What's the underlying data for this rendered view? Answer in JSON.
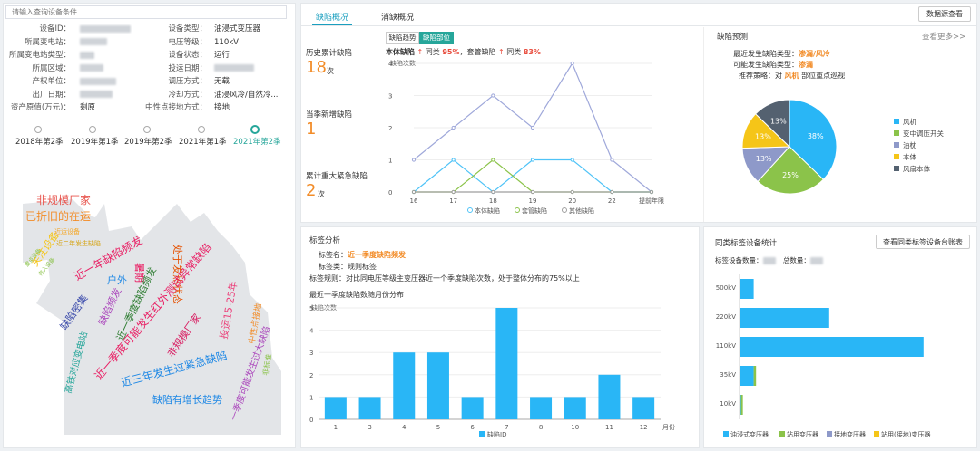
{
  "search": {
    "placeholder": "请输入查询设备条件"
  },
  "equipment_info": {
    "left": [
      {
        "label": "设备ID："
      },
      {
        "label": "所属变电站："
      },
      {
        "label": "所属变电站类型："
      },
      {
        "label": "所属区域："
      },
      {
        "label": "产权单位："
      },
      {
        "label": "出厂日期："
      },
      {
        "label": "资产原值(万元)：",
        "value": "剩原"
      }
    ],
    "right": [
      {
        "label": "设备类型：",
        "value": "油浸式变压器"
      },
      {
        "label": "电压等级：",
        "value": "110kV"
      },
      {
        "label": "设备状态：",
        "value": "运行"
      },
      {
        "label": "投运日期："
      },
      {
        "label": "调压方式：",
        "value": "无载"
      },
      {
        "label": "冷却方式：",
        "value": "油浸风冷/自然冷..."
      },
      {
        "label": "中性点接地方式：",
        "value": "接地"
      }
    ]
  },
  "timeline": {
    "items": [
      "2018年第2季",
      "2019年第1季",
      "2019年第2季",
      "2021年第1季",
      "2021年第2季"
    ],
    "active_index": 4
  },
  "word_cloud": [
    {
      "text": "非规模厂家",
      "color": "#e8554e"
    },
    {
      "text": "已折旧的在运",
      "color": "#f28c28"
    },
    {
      "text": "近运设备",
      "color": "#f5a623"
    },
    {
      "text": "近二年发生缺陷",
      "color": "#d6a517"
    },
    {
      "text": "关注设备",
      "color": "#f5c518"
    },
    {
      "text": "重点设备",
      "color": "#8bc34a"
    },
    {
      "text": "存入设备",
      "color": "#8bc34a"
    },
    {
      "text": "近一年缺陷频发",
      "color": "#e91e63"
    },
    {
      "text": "户外",
      "color": "#1e88e5"
    },
    {
      "text": "暑期",
      "color": "#1e88e5"
    },
    {
      "text": "处于发热状态",
      "color": "#e65100"
    },
    {
      "text": "近一季度缺陷频发",
      "color": "#2e7d32"
    },
    {
      "text": "缺陷密集",
      "color": "#3949ab"
    },
    {
      "text": "缺陷频发",
      "color": "#ab47bc"
    },
    {
      "text": "近三年发生过紧急缺陷",
      "color": "#1e88e5"
    },
    {
      "text": "高铁对应变电站",
      "color": "#26a69a"
    },
    {
      "text": "近一季度可能发生红外测试异常缺陷",
      "color": "#e91e63"
    },
    {
      "text": "缺陷有增长趋势",
      "color": "#1e88e5"
    },
    {
      "text": "非规模厂家",
      "color": "#d81b60"
    },
    {
      "text": "投运15-25年",
      "color": "#ec407a"
    },
    {
      "text": "中性点接地",
      "color": "#f28c28"
    },
    {
      "text": "非标准",
      "color": "#8bc34a"
    },
    {
      "text": "一季度可能发生过大缺陷",
      "color": "#ab47bc"
    },
    {
      "text": "缺陷有增长趋势",
      "color": "#1e88e5"
    }
  ],
  "tabs": {
    "items": [
      "缺陷概况",
      "消缺概况"
    ],
    "active_index": 0
  },
  "data_source_button": "数据源查看",
  "defect_stats": {
    "history_label": "历史累计缺陷",
    "history_value": "18",
    "history_unit": "次",
    "new_label": "当季新增缺陷",
    "new_value": "1",
    "urgent_label": "累计重大紧急缺陷",
    "urgent_value": "2",
    "urgent_unit": "次"
  },
  "trend_chart": {
    "subtabs": [
      "缺陷趋势",
      "缺陷部位"
    ],
    "summary_prefix": "本体缺陷",
    "summary_mid1": "同类",
    "summary_val1": "95%",
    "summary_mid2": "，套管缺陷",
    "summary_mid3": "同类",
    "summary_val2": "83%"
  },
  "prediction": {
    "title": "缺陷预测",
    "more": "查看更多>>",
    "line1_label": "最近发生缺陷类型：",
    "line1_value": "渗漏/风冷",
    "line2_label": "可能发生缺陷类型：",
    "line2_value": "渗漏",
    "line3_prefix": "推荐策略：对",
    "line3_value": "风机",
    "line3_suffix": "部位重点巡视"
  },
  "tag_analysis": {
    "title": "标签分析",
    "name_label": "标签名：",
    "name_value": "近一季度缺陷频发",
    "type_label": "标签类：",
    "type_value": "规则标签",
    "rule_label": "标签规则：",
    "rule_value": "对比同电压等级主变压器近一个季度缺陷次数，处于整体分布的75%以上"
  },
  "same_tag": {
    "title": "同类标签设备统计",
    "button": "查看同类标签设备台账表",
    "count_label": "标签设备数量：",
    "total_label": "总数量："
  },
  "chart_data": [
    {
      "type": "line",
      "title": "",
      "ylabel": "缺陷次数",
      "xlabel": "",
      "x": [
        "16",
        "17",
        "18",
        "19",
        "20",
        "22",
        "提前年限"
      ],
      "ylim": [
        0,
        4
      ],
      "series": [
        {
          "name": "",
          "values": [
            1,
            2,
            3,
            2,
            4,
            1,
            0
          ],
          "color": "#9fa8da"
        },
        {
          "name": "本体缺陷",
          "values": [
            0,
            1,
            0,
            1,
            1,
            0,
            0
          ],
          "color": "#4fc3f7"
        },
        {
          "name": "套管缺陷",
          "values": [
            0,
            0,
            1,
            0,
            0,
            0,
            0
          ],
          "color": "#8bc34a"
        },
        {
          "name": "其他缺陷",
          "values": [
            0,
            0,
            0,
            0,
            0,
            0,
            0
          ],
          "color": "#9e9e9e"
        }
      ]
    },
    {
      "type": "pie",
      "categories": [
        "风机",
        "变中调压开关",
        "油枕",
        "本体",
        "风扇本体"
      ],
      "values": [
        38,
        25,
        13,
        13,
        13
      ],
      "labels": [
        "38%",
        "25%",
        "13%",
        "13%",
        "13%"
      ],
      "colors": [
        "#29b6f6",
        "#8bc34a",
        "#8e99c9",
        "#f5c518",
        "#546170"
      ],
      "legend": "right"
    },
    {
      "type": "bar",
      "title": "最近一季度缺陷数随月份分布",
      "ylabel": "缺陷次数",
      "xlabel": "月份",
      "categories": [
        "1",
        "3",
        "4",
        "5",
        "6",
        "7",
        "8",
        "10",
        "11",
        "12"
      ],
      "values": [
        1,
        1,
        3,
        3,
        1,
        5,
        1,
        1,
        2,
        1
      ],
      "ylim": [
        0,
        5
      ],
      "series_name": "缺陷ID",
      "color": "#29b6f6"
    },
    {
      "type": "bar",
      "orientation": "horizontal",
      "categories": [
        "500kV",
        "220kV",
        "110kV",
        "35kV",
        "10kV"
      ],
      "series": [
        {
          "name": "油浸式变压器",
          "values": [
            3,
            19,
            39,
            3,
            0.3
          ],
          "color": "#29b6f6"
        },
        {
          "name": "站用变压器",
          "values": [
            0,
            0,
            0,
            0.5,
            0.4
          ],
          "color": "#8bc34a"
        },
        {
          "name": "接地变压器",
          "values": [
            0,
            0,
            0,
            0,
            0
          ],
          "color": "#8e99c9"
        },
        {
          "name": "站用(接地)变压器",
          "values": [
            0,
            0,
            0,
            0,
            0
          ],
          "color": "#f5c518"
        }
      ],
      "legend": "bottom"
    }
  ]
}
